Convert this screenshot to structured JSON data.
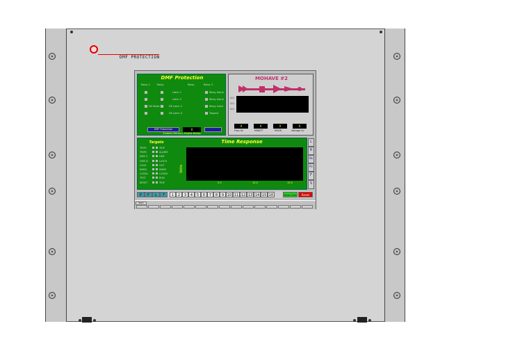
{
  "panel": {
    "title": "DMF PROTECTION"
  },
  "dmf": {
    "title": "DMF Protection",
    "col_headers": [
      "Relay 1",
      "Relay",
      "Relay",
      "Relay 3"
    ],
    "left_labels": [
      "",
      "",
      "DS Mode",
      ""
    ],
    "mid_labels": [
      "Latch 1",
      "Latch 2",
      "DS Latch 3",
      "DS Latch 4"
    ],
    "right_labels": [
      "Relay Alarm",
      "Relay Alarm",
      "Relay Latch",
      "Tripped"
    ],
    "status_left": "DMF Protection",
    "counter_value": "0",
    "footer": "Enables Memory Enable Button"
  },
  "mohave": {
    "title": "MOHAVE #2",
    "scale_ticks": [
      "4.0",
      "2.0",
      "0.0"
    ],
    "readouts": [
      {
        "value": "0",
        "label": "Freq Hz"
      },
      {
        "value": "0",
        "label": "MWATT"
      },
      {
        "value": "0",
        "label": "MVAR"
      },
      {
        "value": "0",
        "label": "Voltage kV"
      }
    ]
  },
  "targets": {
    "title": "Targets",
    "rows": [
      {
        "left": "TRIP1",
        "right": "TRIP"
      },
      {
        "left": "TRIP2",
        "right": "ALARM"
      },
      {
        "left": "DMF-C",
        "right": "DMF"
      },
      {
        "left": "DMF-D",
        "right": "LATCH"
      },
      {
        "left": "LOCK",
        "right": "OUT"
      },
      {
        "left": "INHIB",
        "right": "INHIB"
      },
      {
        "left": "LOCKA",
        "right": "LOCKD"
      },
      {
        "left": "TEST",
        "right": "RUN"
      },
      {
        "left": "RESET",
        "right": "TRIP"
      }
    ]
  },
  "time_response": {
    "title": "Time Response",
    "ylabel": "Volts",
    "x_ticks": [
      "5.0",
      "10.0",
      "15.0"
    ]
  },
  "side_buttons": [
    "L",
    "R",
    "Nx",
    "Pv",
    "F",
    "S"
  ],
  "bottom_bar": {
    "mode_buttons": [
      "P",
      "F",
      "L",
      "T"
    ],
    "numbers": [
      "1",
      "2",
      "3",
      "4",
      "5",
      "6",
      "7",
      "8",
      "9",
      "10",
      "11",
      "12",
      "13",
      "14",
      "15",
      "16"
    ],
    "green_button": "Mem Card",
    "red_button": "Reset"
  },
  "taskbar": {
    "start": "Start"
  },
  "colors": {
    "accent": "#0f8a0f",
    "alarm": "#e00000",
    "title_yellow": "#ffff33",
    "magenta": "#c0306a"
  }
}
